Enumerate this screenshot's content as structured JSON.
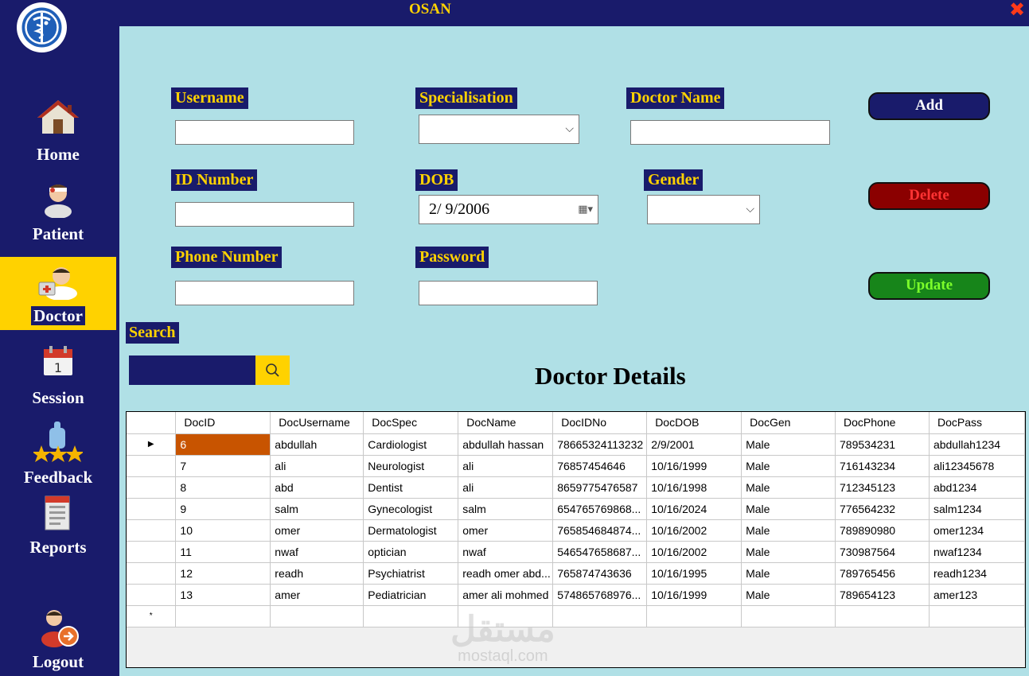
{
  "window": {
    "title": "OSAN",
    "close_icon": "close-icon"
  },
  "sidebar": {
    "logo_icon": "caduceus-logo-icon",
    "items": [
      {
        "label": "Home",
        "icon": "house-icon"
      },
      {
        "label": "Patient",
        "icon": "patient-icon"
      },
      {
        "label": "Doctor",
        "icon": "doctor-icon",
        "active": true
      },
      {
        "label": "Session",
        "icon": "calendar-icon"
      },
      {
        "label": "Feedback",
        "icon": "thumbs-up-stars-icon"
      },
      {
        "label": "Reports",
        "icon": "report-icon"
      },
      {
        "label": "Logout",
        "icon": "logout-icon"
      }
    ]
  },
  "form": {
    "username_label": "Username",
    "username_value": "",
    "specialisation_label": "Specialisation",
    "specialisation_value": "",
    "doctor_name_label": "Doctor Name",
    "doctor_name_value": "",
    "id_number_label": "ID Number",
    "id_number_value": "",
    "dob_label": "DOB",
    "dob_value": "2/ 9/2006",
    "gender_label": "Gender",
    "gender_value": "",
    "phone_label": "Phone Number",
    "phone_value": "",
    "password_label": "Password",
    "password_value": ""
  },
  "buttons": {
    "add": "Add",
    "delete": "Delete",
    "update": "Update"
  },
  "search": {
    "label": "Search",
    "value": "",
    "icon": "search-icon"
  },
  "grid": {
    "title": "Doctor Details",
    "columns": [
      "DocID",
      "DocUsername",
      "DocSpec",
      "DocName",
      "DocIDNo",
      "DocDOB",
      "DocGen",
      "DocPhone",
      "DocPass"
    ],
    "rows": [
      [
        "6",
        "abdullah",
        "Cardiologist",
        "abdullah hassan",
        "78665324113232",
        "2/9/2001",
        "Male",
        "789534231",
        "abdullah1234"
      ],
      [
        "7",
        "ali",
        "Neurologist",
        "ali",
        "76857454646",
        "10/16/1999",
        "Male",
        "716143234",
        "ali12345678"
      ],
      [
        "8",
        "abd",
        "Dentist",
        "ali",
        "8659775476587",
        "10/16/1998",
        "Male",
        "712345123",
        "abd1234"
      ],
      [
        "9",
        "salm",
        "Gynecologist",
        "salm",
        "654765769868...",
        "10/16/2024",
        "Male",
        "776564232",
        "salm1234"
      ],
      [
        "10",
        "omer",
        "Dermatologist",
        "omer",
        "765854684874...",
        "10/16/2002",
        "Male",
        "789890980",
        "omer1234"
      ],
      [
        "11",
        "nwaf",
        "optician",
        "nwaf",
        "546547658687...",
        "10/16/2002",
        "Male",
        "730987564",
        "nwaf1234"
      ],
      [
        "12",
        "readh",
        "Psychiatrist",
        "readh omer abd...",
        "765874743636",
        "10/16/1995",
        "Male",
        "789765456",
        "readh1234"
      ],
      [
        "13",
        "amer",
        "Pediatrician",
        "amer ali mohmed",
        "574865768976...",
        "10/16/1999",
        "Male",
        "789654123",
        "amer123"
      ]
    ],
    "current_row_marker": "▶",
    "new_row_marker": "*"
  },
  "watermark": {
    "arabic": "مستقل",
    "latin": "mostaql.com"
  },
  "colors": {
    "sidebar_bg": "#191b6b",
    "main_bg": "#b0e0e6",
    "accent_yellow": "#ffd200",
    "delete_red": "#8b0000",
    "update_green": "#17851a",
    "selected_cell": "#c85400"
  }
}
